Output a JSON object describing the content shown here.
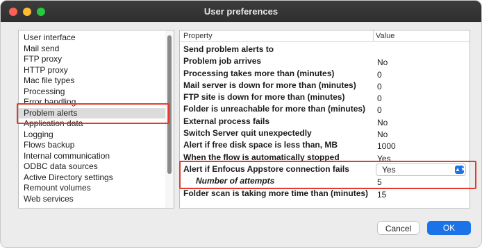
{
  "window": {
    "title": "User preferences"
  },
  "categories": [
    "User interface",
    "Mail send",
    "FTP proxy",
    "HTTP proxy",
    "Mac file types",
    "Processing",
    "Error handling",
    "Problem alerts",
    "Application data",
    "Logging",
    "Flows backup",
    "Internal communication",
    "ODBC data sources",
    "Active Directory settings",
    "Remount volumes",
    "Web services"
  ],
  "selected_category": "Problem alerts",
  "table": {
    "headers": {
      "property": "Property",
      "value": "Value"
    },
    "rows": [
      {
        "property": "Send problem alerts to",
        "value": ""
      },
      {
        "property": "Problem job arrives",
        "value": "No"
      },
      {
        "property": "Processing takes more than (minutes)",
        "value": "0"
      },
      {
        "property": "Mail server is down for more than (minutes)",
        "value": "0"
      },
      {
        "property": "FTP site is down for more than (minutes)",
        "value": "0"
      },
      {
        "property": "Folder is unreachable for more than (minutes)",
        "value": "0"
      },
      {
        "property": "External process fails",
        "value": "No"
      },
      {
        "property": "Switch Server quit unexpectedly",
        "value": "No"
      },
      {
        "property": "Alert if free disk space is less than, MB",
        "value": "1000"
      },
      {
        "property": "When the flow is automatically stopped",
        "value": "Yes"
      },
      {
        "property": "Alert if Enfocus Appstore connection fails",
        "value": "Yes"
      },
      {
        "property": "Number of attempts",
        "value": "5"
      },
      {
        "property": "Folder scan is taking more time than (minutes)",
        "value": "15"
      }
    ]
  },
  "buttons": {
    "cancel": "Cancel",
    "ok": "OK"
  },
  "colors": {
    "highlight": "#e23b2e",
    "accent": "#1a73e8",
    "selection": "#dcdcdc"
  }
}
